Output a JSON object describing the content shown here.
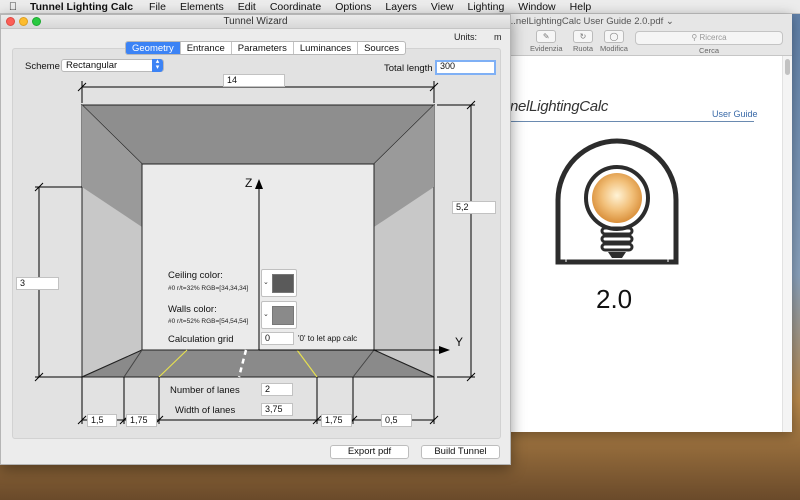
{
  "menubar": {
    "app_name": "Tunnel Lighting Calc",
    "items": [
      "File",
      "Elements",
      "Edit",
      "Coordinate",
      "Options",
      "Layers",
      "View",
      "Lighting",
      "Window",
      "Help"
    ]
  },
  "pdf_window": {
    "title": "...nelLightingCalc User Guide 2.0.pdf ⌄",
    "toolbar": [
      "Evidenzia",
      "Ruota",
      "Modifica"
    ],
    "search_placeholder": "Ricerca",
    "search_label": "Cerca",
    "brand": "nelLightingCalc",
    "user_guide": "User Guide",
    "version": "2.0"
  },
  "wizard": {
    "title": "Tunnel Wizard",
    "units_label": "Units:",
    "units_value": "m",
    "tabs": [
      "Geometry",
      "Entrance",
      "Parameters",
      "Luminances",
      "Sources"
    ],
    "active_tab": "Geometry",
    "scheme_label": "Scheme",
    "scheme_value": "Rectangular",
    "total_length_label": "Total length",
    "total_length_value": "300",
    "width_top": "14",
    "height_right": "5,2",
    "height_left": "3",
    "axis_z": "Z",
    "axis_y": "Y",
    "ceiling_color_label": "Ceiling color:",
    "ceiling_color_info": "#0 r/t=32% RGB=[34,34,34]",
    "walls_color_label": "Walls color:",
    "walls_color_info": "#0 r/t=52% RGB=[54,54,54]",
    "calc_grid_label": "Calculation grid",
    "calc_grid_value": "0",
    "calc_grid_hint": "'0' to let app calc",
    "num_lanes_label": "Number of lanes",
    "num_lanes_value": "2",
    "lane_width_label": "Width of lanes",
    "lane_width_value": "3,75",
    "dim_left_outer": "1,5",
    "dim_left_inner": "1,75",
    "dim_right_inner": "1,75",
    "dim_right_outer": "0,5",
    "export_button": "Export pdf",
    "build_button": "Build Tunnel",
    "colors": {
      "ceiling_swatch": "#5a5a5a",
      "walls_swatch": "#8a8a8a",
      "accent": "#3c83f5",
      "road_line": "#e6e050"
    }
  }
}
